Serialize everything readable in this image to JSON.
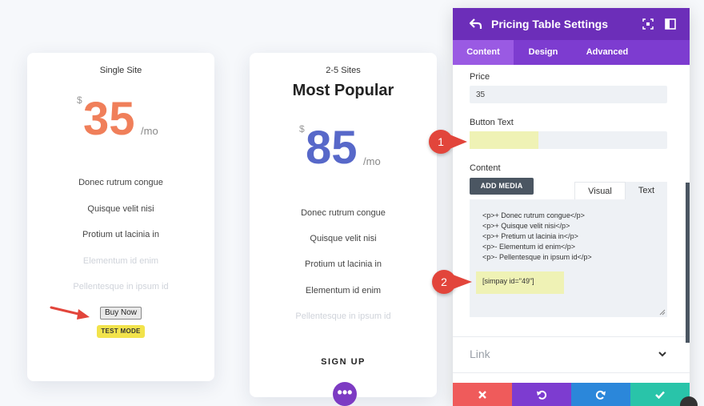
{
  "cards": [
    {
      "plan": "Single Site",
      "currency": "$",
      "amount": "35",
      "per": "/mo",
      "features": [
        {
          "text": "Donec rutrum congue",
          "on": true
        },
        {
          "text": "Quisque velit nisi",
          "on": true
        },
        {
          "text": "Protium ut lacinia in",
          "on": true
        },
        {
          "text": "Elementum id enim",
          "on": false
        },
        {
          "text": "Pellentesque in ipsum id",
          "on": false
        }
      ],
      "buy_label": "Buy Now",
      "test_mode": "TEST MODE"
    },
    {
      "plan": "2-5 Sites",
      "subtitle": "Most Popular",
      "currency": "$",
      "amount": "85",
      "per": "/mo",
      "features": [
        {
          "text": "Donec rutrum congue",
          "on": true
        },
        {
          "text": "Quisque velit nisi",
          "on": true
        },
        {
          "text": "Protium ut lacinia in",
          "on": true
        },
        {
          "text": "Elementum id enim",
          "on": true
        },
        {
          "text": "Pellentesque in ipsum id",
          "on": false
        }
      ],
      "signup_label": "SIGN UP"
    }
  ],
  "more_button": "•••",
  "panel": {
    "title": "Pricing Table Settings",
    "tabs": [
      "Content",
      "Design",
      "Advanced"
    ],
    "price_label": "Price",
    "price_value": "35",
    "button_text_label": "Button Text",
    "button_text_value": "",
    "content_label": "Content",
    "add_media": "ADD MEDIA",
    "editor_tabs": [
      "Visual",
      "Text"
    ],
    "code_lines": [
      "<p>+ Donec rutrum congue</p>",
      "<p>+ Quisque velit nisi</p>",
      "<p>+ Pretium ut lacinia in</p>",
      "<p>- Elementum id enim</p>",
      "<p>- Pellentesque in ipsum id</p>"
    ],
    "shortcode": "[simpay id=\"49\"]",
    "link_label": "Link"
  },
  "badges": [
    "1",
    "2"
  ],
  "colors": {
    "header": "#6c2eb9",
    "tabs": "#7d3cd0",
    "cancel": "#ef5b5b",
    "undo": "#7d3cd0",
    "redo": "#2b87da",
    "save": "#29c4a9"
  }
}
